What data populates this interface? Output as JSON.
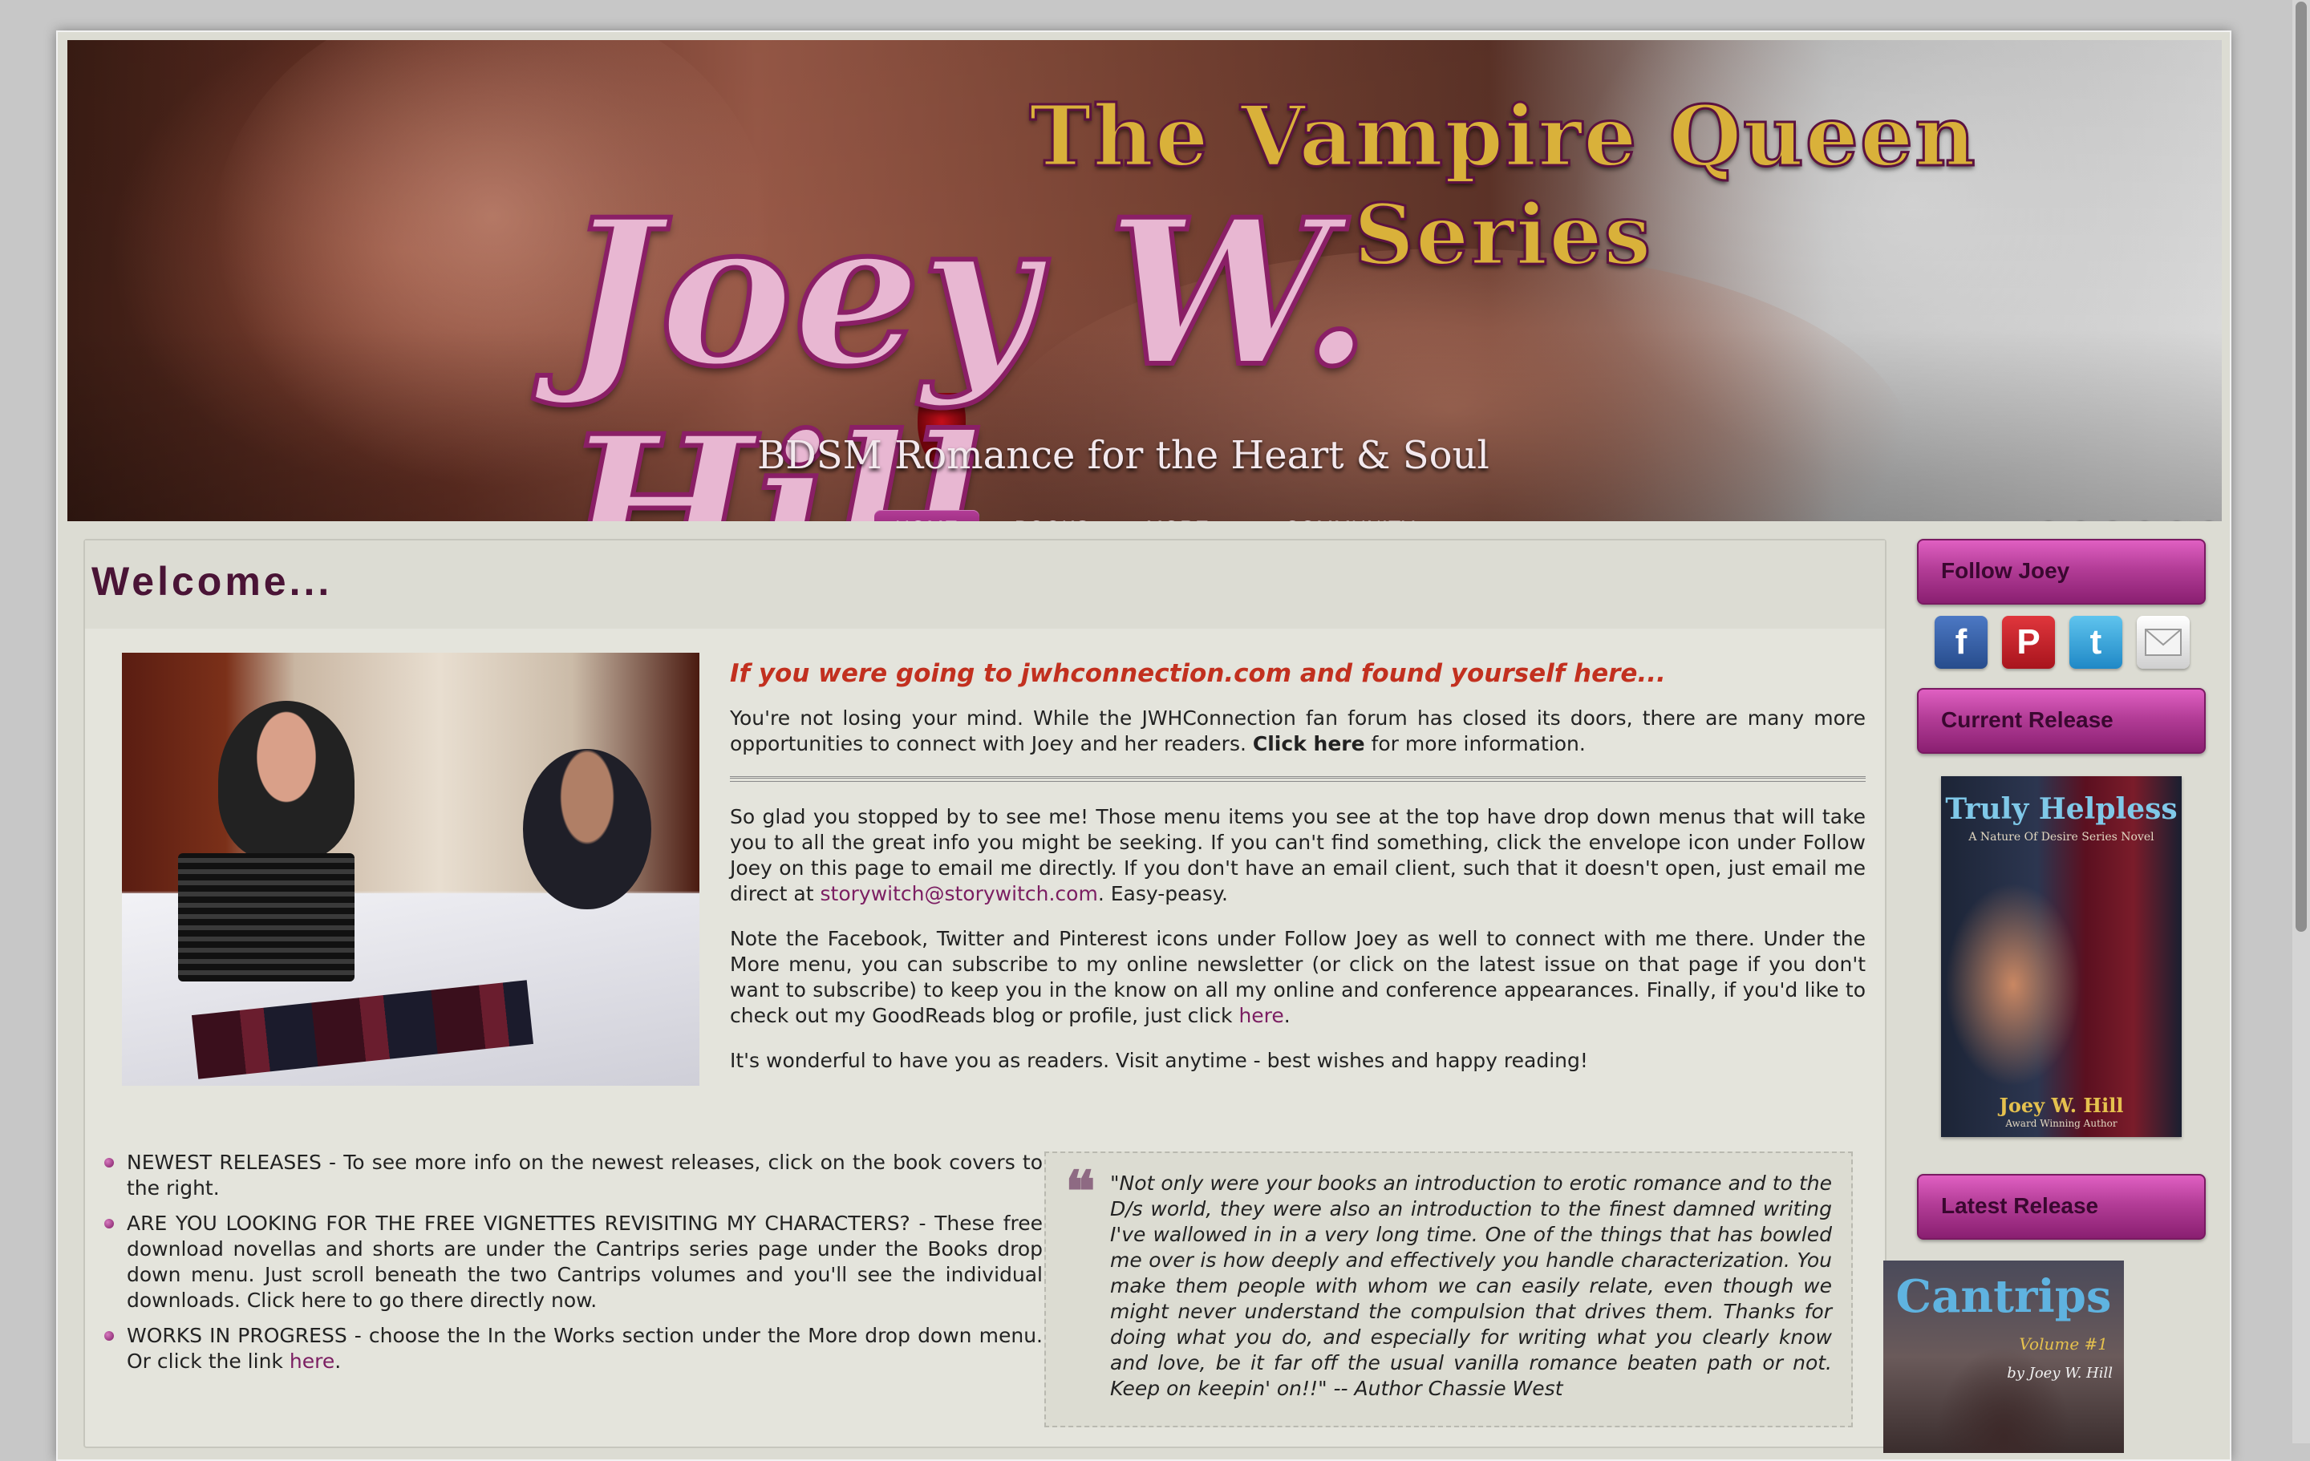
{
  "header": {
    "series_title": "The Vampire Queen Series",
    "author_name": "Joey W. Hill",
    "tagline": "BDSM Romance for the Heart & Soul",
    "nav": [
      {
        "label": "HOME",
        "active": true
      },
      {
        "label": "BOOKS",
        "active": false
      },
      {
        "label": "MORE...",
        "active": false
      },
      {
        "label": "COMMUNITY",
        "active": false
      }
    ],
    "slides": {
      "count": 6,
      "active_index": 2
    }
  },
  "main": {
    "heading": "Welcome...",
    "headline": "If you were going to jwhconnection.com and found yourself here...",
    "para1_pre": "You're not losing your mind. While the JWHConnection fan forum has closed its doors, there are many more opportunities to connect with Joey and her readers. ",
    "para1_link": "Click here",
    "para1_post": " for more information.",
    "para2_pre": "So glad you stopped by to see me! Those menu items you see at the top have drop down menus that will take you to all the great info you might be seeking. If you can't find something, click the envelope icon under Follow Joey on this page to email me directly. If you don't have an email client, such that it doesn't open, just email me direct at ",
    "para2_email": "storywitch@storywitch.com",
    "para2_post": ". Easy-peasy.",
    "para3_pre": "Note the Facebook, Twitter and Pinterest icons under Follow Joey as well to connect with me there. Under the More menu, you can subscribe to my online newsletter (or click on the latest issue on that page if you don't want to subscribe) to keep you in the know on all my online and conference appearances. Finally, if you'd like to check out my GoodReads blog or profile, just click ",
    "para3_link": "here",
    "para3_post": ".",
    "para4": "It's wonderful to have you as readers. Visit anytime - best wishes and happy reading!",
    "bullets": [
      {
        "text": "NEWEST RELEASES - To see more info on the newest releases, click on the book covers to the right."
      },
      {
        "text": "ARE YOU LOOKING FOR THE FREE VIGNETTES REVISITING MY CHARACTERS? - These free download novellas and shorts are under the Cantrips series page under the Books drop down menu. Just scroll beneath the two Cantrips volumes and you'll see the individual downloads. Click here to go there directly now."
      },
      {
        "text_pre": "WORKS IN PROGRESS - choose the In the Works section under the More drop down menu. Or click the link ",
        "link": "here",
        "text_post": "."
      }
    ],
    "quote_mark": "❝",
    "quote": "\"Not only were your books an introduction to erotic romance and to the D/s world, they were also an introduction to the finest damned writing I've wallowed in in a very long time. One of the things that has bowled me over is how deeply and effectively you handle characterization. You make them people with whom we can easily relate, even though we might never understand the compulsion that drives them.  Thanks for doing what you do, and especially for writing what you clearly know and love, be it far off the usual vanilla romance beaten path or not.  Keep on keepin' on!!\" -- Author Chassie West"
  },
  "sidebar": {
    "follow_heading": "Follow Joey",
    "social": [
      {
        "name": "facebook-icon",
        "glyph": "f"
      },
      {
        "name": "pinterest-icon",
        "glyph": "P"
      },
      {
        "name": "twitter-icon",
        "glyph": "t"
      },
      {
        "name": "envelope-icon",
        "glyph": ""
      }
    ],
    "current_heading": "Current Release",
    "current_cover": {
      "title": "Truly Helpless",
      "subtitle": "A Nature Of Desire Series Novel",
      "author": "Joey W. Hill",
      "author_note": "Award Winning Author"
    },
    "latest_heading": "Latest Release",
    "latest_cover": {
      "title": "Cantrips",
      "volume": "Volume #1",
      "author": "by Joey W. Hill"
    }
  }
}
